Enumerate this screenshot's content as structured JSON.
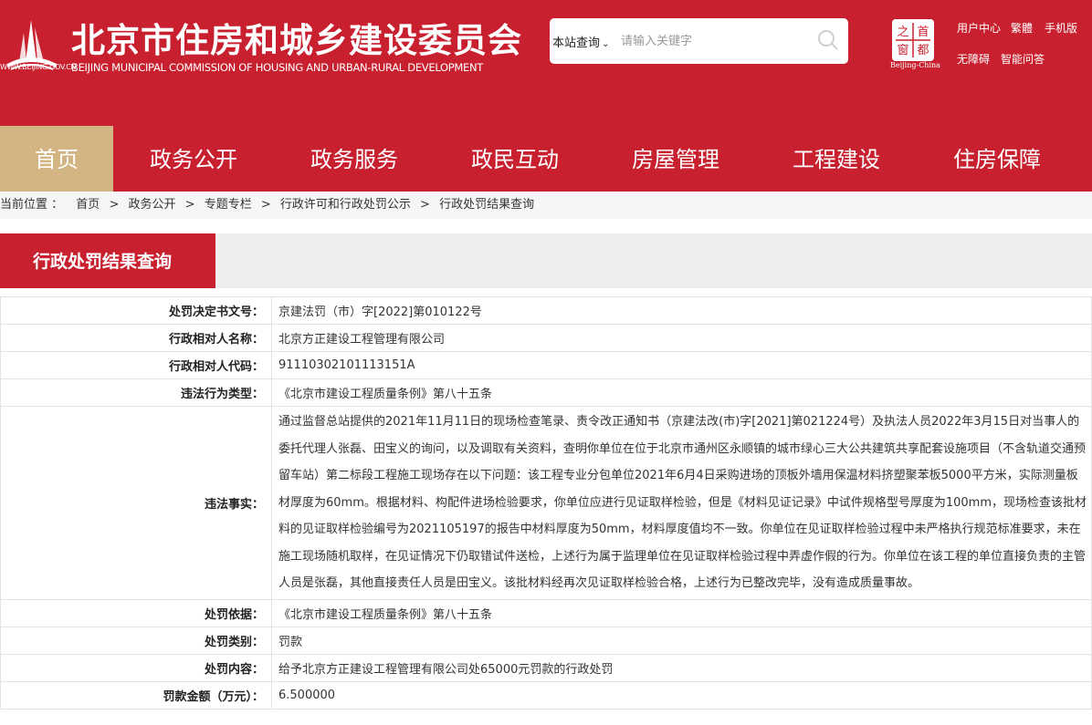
{
  "header": {
    "logo_url_text": "WWW.BEIJING.GOV.CN",
    "title": "北京市住房和城乡建设委员会",
    "subtitle": "BEIJING MUNICIPAL COMMISSION OF HOUSING AND URBAN-RURAL DEVELOPMENT",
    "search": {
      "scope": "本站查询",
      "placeholder": "请输入关键字"
    },
    "capital_logo": {
      "chars": [
        "之",
        "首",
        "窗",
        "都"
      ],
      "caption": "Beijing-China"
    },
    "links": [
      "用户中心",
      "繁體",
      "手机版",
      "无障碍",
      "智能问答"
    ],
    "brand_color": "#c8202f",
    "accent_color": "#d3b483"
  },
  "nav": {
    "items": [
      "首页",
      "政务公开",
      "政务服务",
      "政民互动",
      "房屋管理",
      "工程建设",
      "住房保障"
    ],
    "active_index": 0
  },
  "breadcrumb": {
    "prefix": "当前位置 ：",
    "items": [
      "首页",
      "政务公开",
      "专题专栏",
      "行政许可和行政处罚公示",
      "行政处罚结果查询"
    ],
    "separator": ">"
  },
  "section": {
    "title": "行政处罚结果查询"
  },
  "details": [
    {
      "label": "处罚决定书文号：",
      "value": "京建法罚（市）字[2022]第010122号"
    },
    {
      "label": "行政相对人名称：",
      "value": "北京方正建设工程管理有限公司"
    },
    {
      "label": "行政相对人代码：",
      "value": "91110302101113151A"
    },
    {
      "label": "违法行为类型：",
      "value": "《北京市建设工程质量条例》第八十五条"
    },
    {
      "label": "违法事实：",
      "value": "通过监督总站提供的2021年11月11日的现场检查笔录、责令改正通知书（京建法改(市)字[2021]第021224号）及执法人员2022年3月15日对当事人的委托代理人张磊、田宝义的询问，以及调取有关资料，查明你单位在位于北京市通州区永顺镇的城市绿心三大公共建筑共享配套设施项目（不含轨道交通预留车站）第二标段工程施工现场存在以下问题：该工程专业分包单位2021年6月4日采购进场的顶板外墙用保温材料挤塑聚苯板5000平方米，实际测量板材厚度为60mm。根据材料、构配件进场检验要求，你单位应进行见证取样检验，但是《材料见证记录》中试件规格型号厚度为100mm，现场检查该批材料的见证取样检验编号为2021105197的报告中材料厚度为50mm，材料厚度值均不一致。你单位在见证取样检验过程中未严格执行规范标准要求，未在施工现场随机取样，在见证情况下仍取错试件送检，上述行为属于监理单位在见证取样检验过程中弄虚作假的行为。你单位在该工程的单位直接负责的主管人员是张磊，其他直接责任人员是田宝义。该批材料经再次见证取样检验合格，上述行为已整改完毕，没有造成质量事故。"
    },
    {
      "label": "处罚依据：",
      "value": "《北京市建设工程质量条例》第八十五条"
    },
    {
      "label": "处罚类别：",
      "value": "罚款"
    },
    {
      "label": "处罚内容：",
      "value": "给予北京方正建设工程管理有限公司处65000元罚款的行政处罚"
    },
    {
      "label": "罚款金额（万元）：",
      "value": "6.500000"
    }
  ]
}
